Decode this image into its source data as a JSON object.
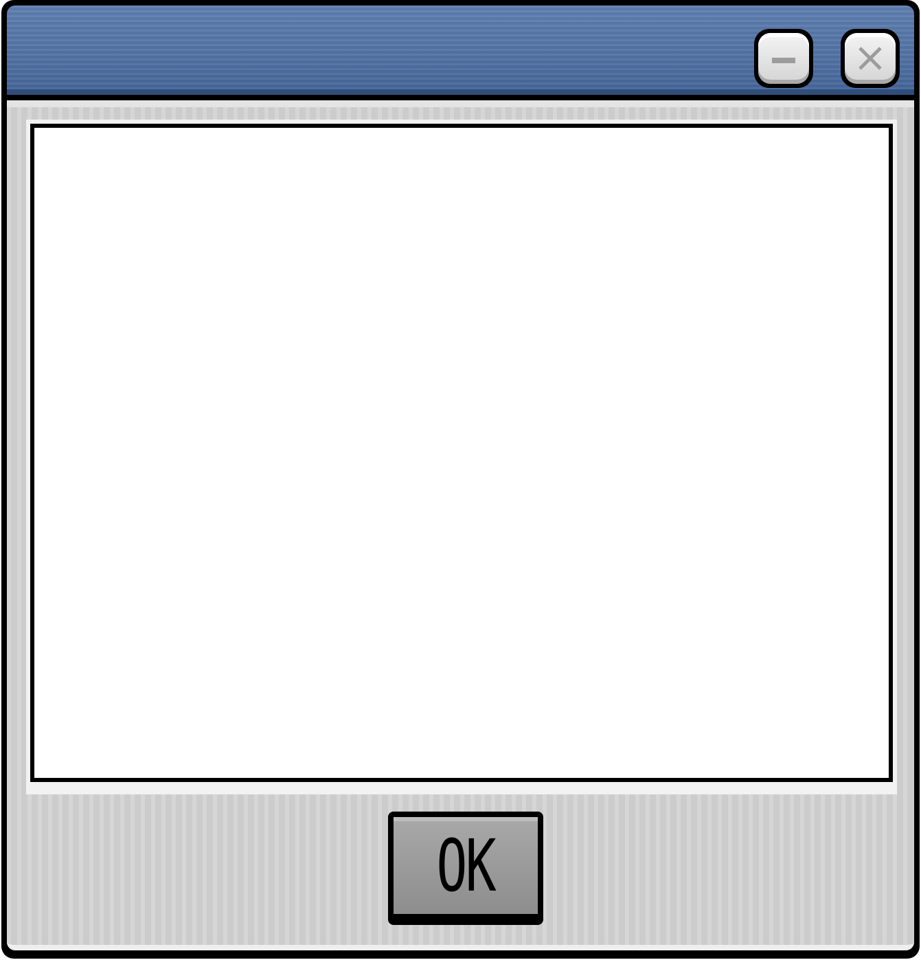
{
  "window": {
    "title": "",
    "titlebar_color": "#5374a6",
    "controls": [
      {
        "name": "minimize",
        "icon": "minimize-icon"
      },
      {
        "name": "close",
        "icon": "close-icon"
      }
    ]
  },
  "content": {
    "text": ""
  },
  "footer": {
    "ok_label": "OK"
  }
}
